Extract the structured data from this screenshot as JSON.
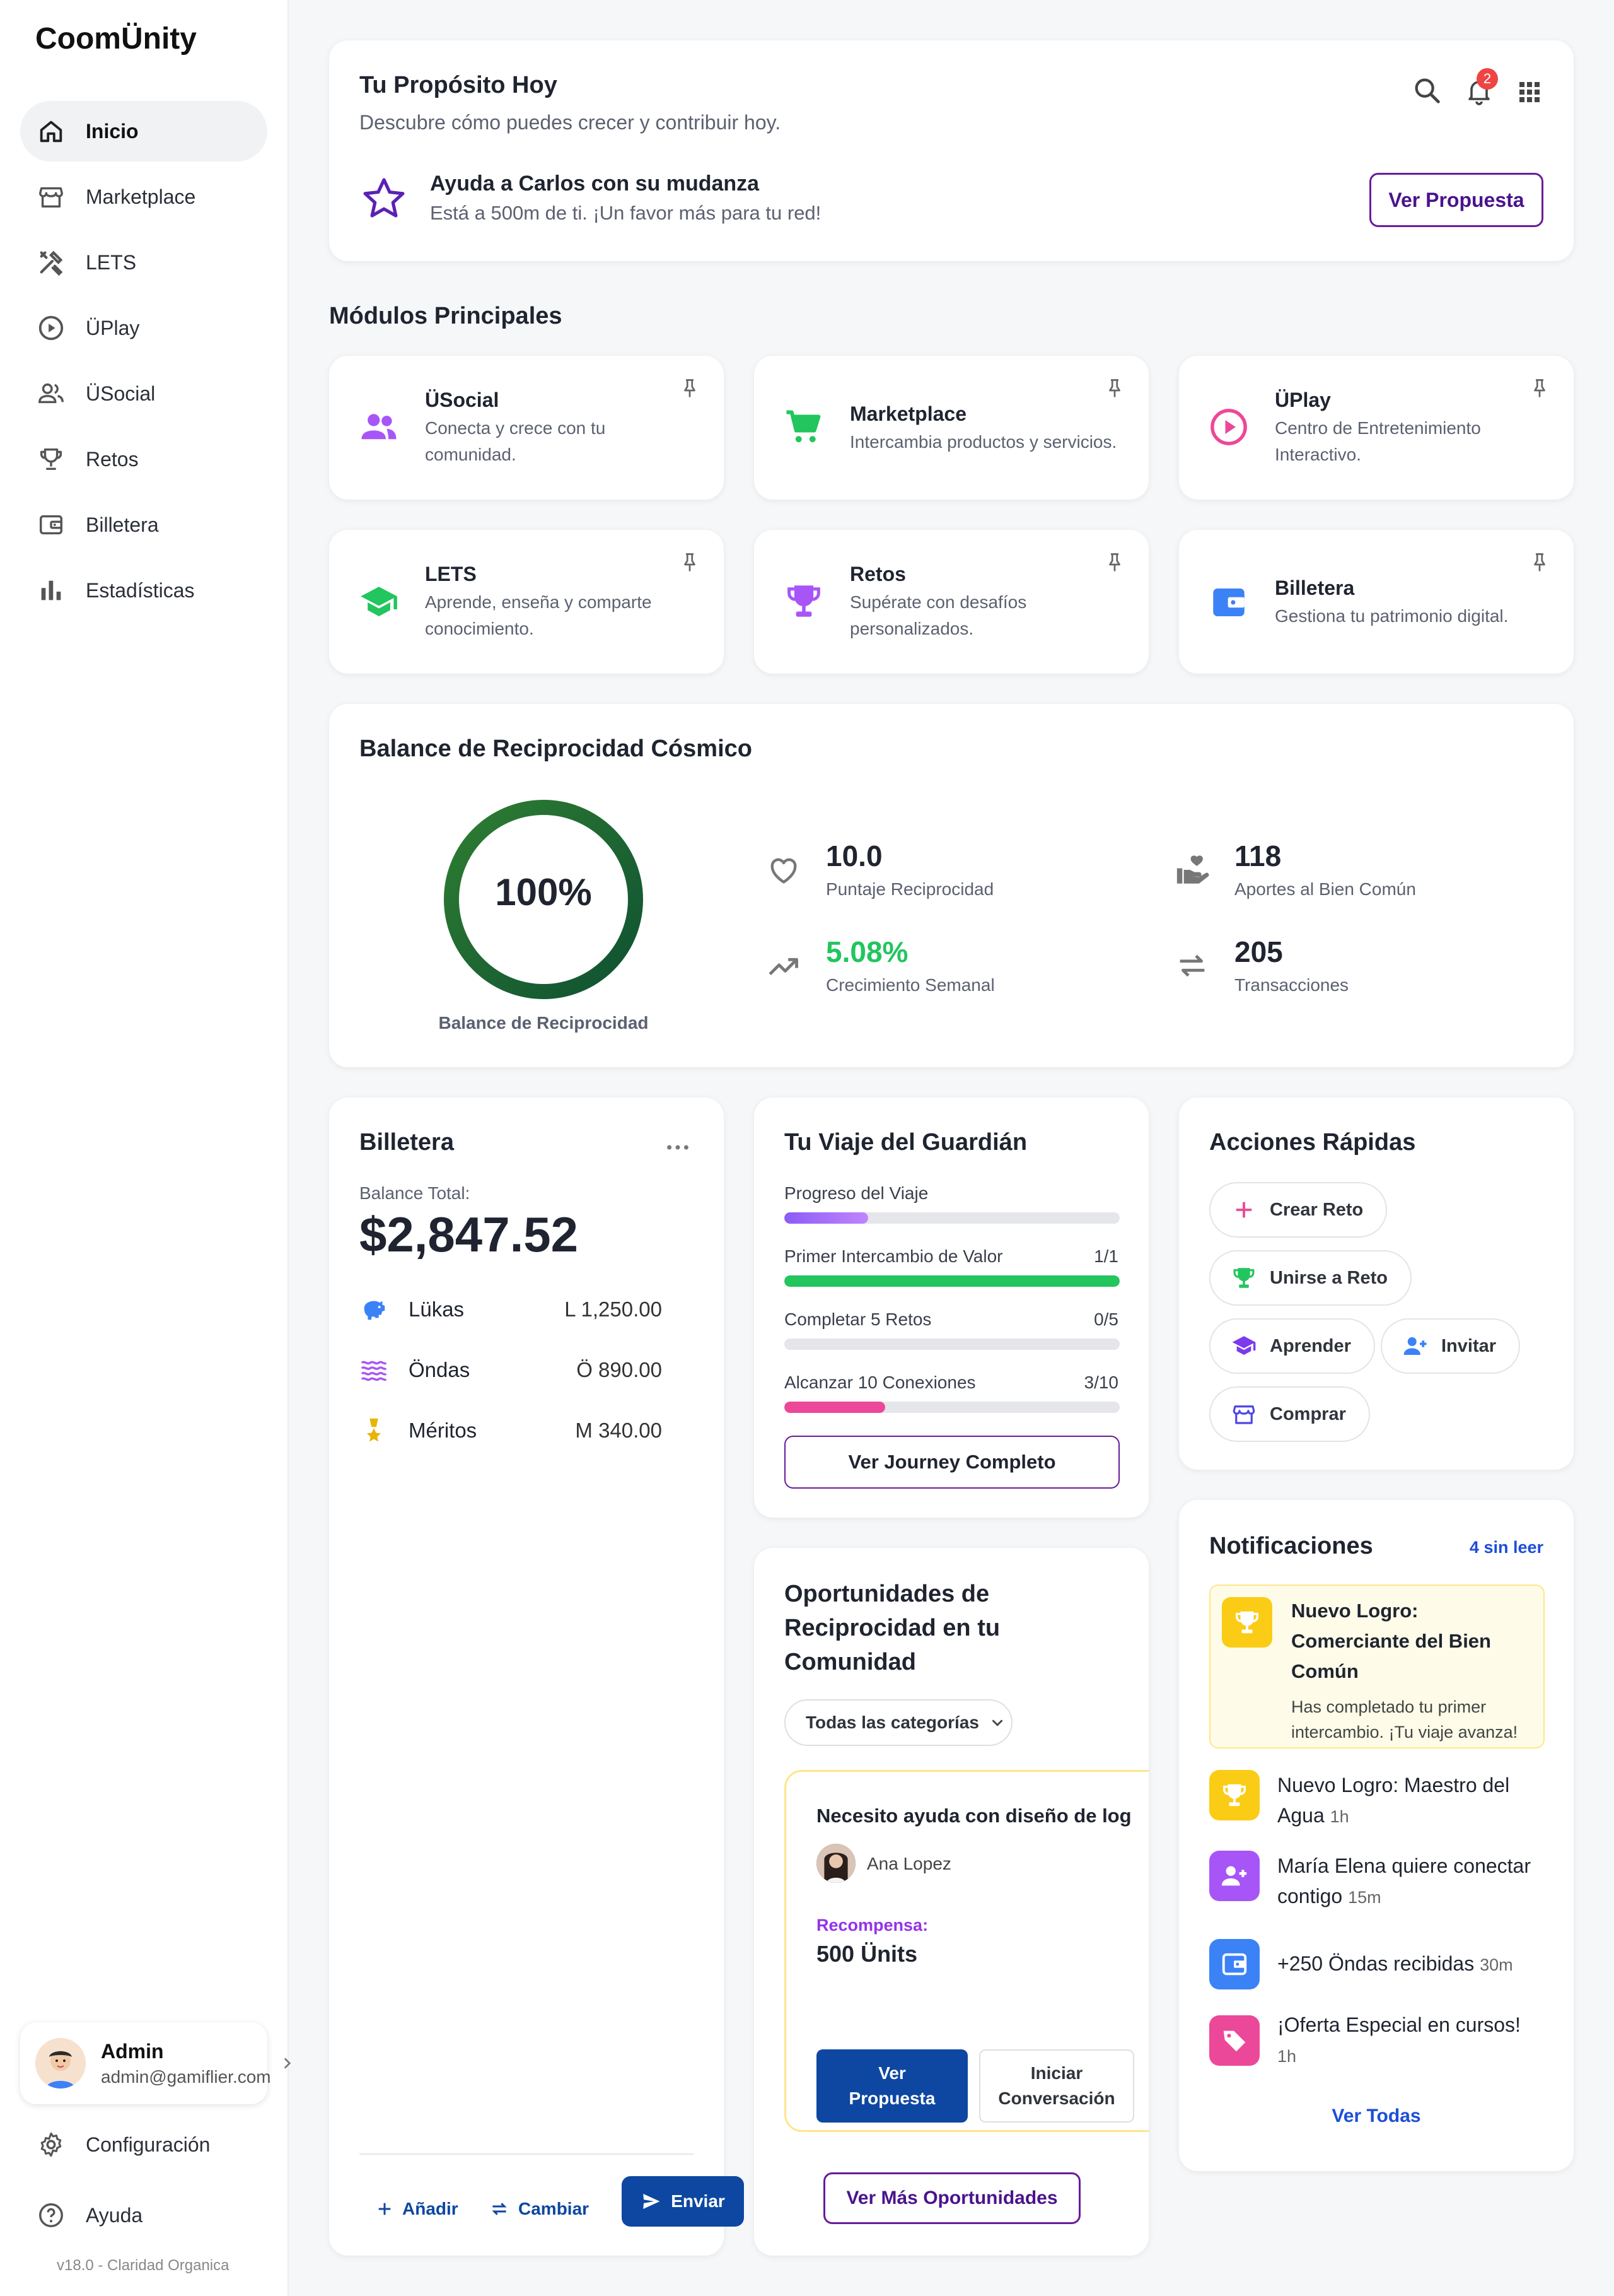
{
  "app": {
    "logo": "CoomÜnity",
    "version": "v18.0 - Claridad Organica"
  },
  "sidebar": {
    "items": [
      {
        "label": "Inicio",
        "icon": "home-icon",
        "active": true
      },
      {
        "label": "Marketplace",
        "icon": "store-icon"
      },
      {
        "label": "LETS",
        "icon": "tools-icon"
      },
      {
        "label": "ÜPlay",
        "icon": "play-circle-icon"
      },
      {
        "label": "ÜSocial",
        "icon": "people-icon"
      },
      {
        "label": "Retos",
        "icon": "trophy-icon"
      },
      {
        "label": "Billetera",
        "icon": "wallet-icon"
      },
      {
        "label": "Estadísticas",
        "icon": "bar-chart-icon"
      }
    ],
    "user": {
      "name": "Admin",
      "email": "admin@gamiflier.com"
    },
    "settings_label": "Configuración",
    "help_label": "Ayuda"
  },
  "purpose": {
    "title": "Tu Propósito Hoy",
    "subtitle": "Descubre cómo puedes crecer y contribuir hoy.",
    "notification_count": "2",
    "task_title": "Ayuda a Carlos con su mudanza",
    "task_desc": "Está a 500m de ti. ¡Un favor más para tu red!",
    "button": "Ver Propuesta"
  },
  "modules": {
    "title": "Módulos Principales",
    "items": [
      {
        "title": "ÜSocial",
        "desc": "Conecta y crece con tu comunidad.",
        "icon": "people-icon",
        "color": "#a855f7"
      },
      {
        "title": "Marketplace",
        "desc": "Intercambia productos y servicios.",
        "icon": "cart-icon",
        "color": "#22c55e"
      },
      {
        "title": "ÜPlay",
        "desc": "Centro de Entretenimiento Interactivo.",
        "icon": "play-circle-icon",
        "color": "#ec4899"
      },
      {
        "title": "LETS",
        "desc": "Aprende, enseña y comparte conocimiento.",
        "icon": "school-icon",
        "color": "#22c55e"
      },
      {
        "title": "Retos",
        "desc": "Supérate con desafíos personalizados.",
        "icon": "trophy-icon",
        "color": "#a855f7"
      },
      {
        "title": "Billetera",
        "desc": "Gestiona tu patrimonio digital.",
        "icon": "wallet-icon",
        "color": "#3b82f6"
      }
    ]
  },
  "balance": {
    "title": "Balance de Reciprocidad Cósmico",
    "percent": "100%",
    "percent_value": 1.0,
    "ring_label": "Balance de Reciprocidad",
    "stats": [
      {
        "value": "10.0",
        "label": "Puntaje Reciprocidad",
        "icon": "heart-icon"
      },
      {
        "value": "118",
        "label": "Aportes al Bien Común",
        "icon": "volunteer-icon"
      },
      {
        "value": "5.08%",
        "label": "Crecimiento Semanal",
        "icon": "trending-up-icon",
        "color": "#22c55e"
      },
      {
        "value": "205",
        "label": "Transacciones",
        "icon": "swap-icon"
      }
    ]
  },
  "wallet": {
    "title": "Billetera",
    "balance_label": "Balance Total:",
    "balance": "$2,847.52",
    "rows": [
      {
        "label": "Lükas",
        "amount": "L 1,250.00",
        "icon": "piggy-bank-icon"
      },
      {
        "label": "Öndas",
        "amount": "Ö 890.00",
        "icon": "waves-icon"
      },
      {
        "label": "Méritos",
        "amount": "M 340.00",
        "icon": "medal-icon"
      }
    ],
    "add": "Añadir",
    "exchange": "Cambiar",
    "send": "Enviar"
  },
  "journey": {
    "title": "Tu Viaje del Guardián",
    "progress_label": "Progreso del Viaje",
    "progress_value": 0.25,
    "steps": [
      {
        "label": "Primer Intercambio de Valor",
        "count": "1/1",
        "value": 1.0,
        "color": "#22c55e"
      },
      {
        "label": "Completar 5 Retos",
        "count": "0/5",
        "value": 0.0,
        "color": "#a855f7"
      },
      {
        "label": "Alcanzar 10 Conexiones",
        "count": "3/10",
        "value": 0.3,
        "color": "#ec4899"
      }
    ],
    "button": "Ver Journey Completo"
  },
  "quick": {
    "title": "Acciones Rápidas",
    "items": [
      {
        "label": "Crear Reto",
        "icon": "plus-icon"
      },
      {
        "label": "Unirse a Reto",
        "icon": "trophy-icon"
      },
      {
        "label": "Aprender",
        "icon": "school-icon"
      },
      {
        "label": "Invitar",
        "icon": "person-add-icon"
      },
      {
        "label": "Comprar",
        "icon": "store-icon"
      }
    ]
  },
  "opportunities": {
    "title_lines": [
      "Oportunidades de",
      "Reciprocidad en tu",
      "Comunidad"
    ],
    "filter": "Todas las categorías",
    "card": {
      "title": "Necesito ayuda con diseño de log",
      "author": "Ana Lopez",
      "reward_label": "Recompensa:",
      "reward": "500 Ünits",
      "primary_lines": [
        "Ver",
        "Propuesta"
      ],
      "secondary_lines": [
        "Iniciar",
        "Conversación"
      ]
    },
    "more": "Ver Más Oportunidades"
  },
  "notifications": {
    "title": "Notificaciones",
    "unread": "4 sin leer",
    "featured": {
      "title_lines": [
        "Nuevo Logro:",
        "Comerciante del Bien",
        "Común"
      ],
      "desc_lines": [
        "Has completado tu primer",
        "intercambio. ¡Tu viaje avanza!"
      ]
    },
    "items": [
      {
        "lines": [
          "Nuevo Logro: Maestro del",
          "Agua"
        ],
        "time": "1h",
        "icon": "trophy-icon",
        "color": "#facc15"
      },
      {
        "lines": [
          "María Elena quiere conectar",
          "contigo"
        ],
        "time": "15m",
        "icon": "person-add-icon",
        "color": "#a855f7"
      },
      {
        "lines": [
          "+250 Öndas recibidas"
        ],
        "time": "30m",
        "icon": "wallet-icon",
        "color": "#3b82f6"
      },
      {
        "lines": [
          "¡Oferta Especial en cursos!"
        ],
        "time": "1h",
        "icon": "tag-icon",
        "color": "#ec4899"
      }
    ],
    "view_all": "Ver Todas"
  }
}
